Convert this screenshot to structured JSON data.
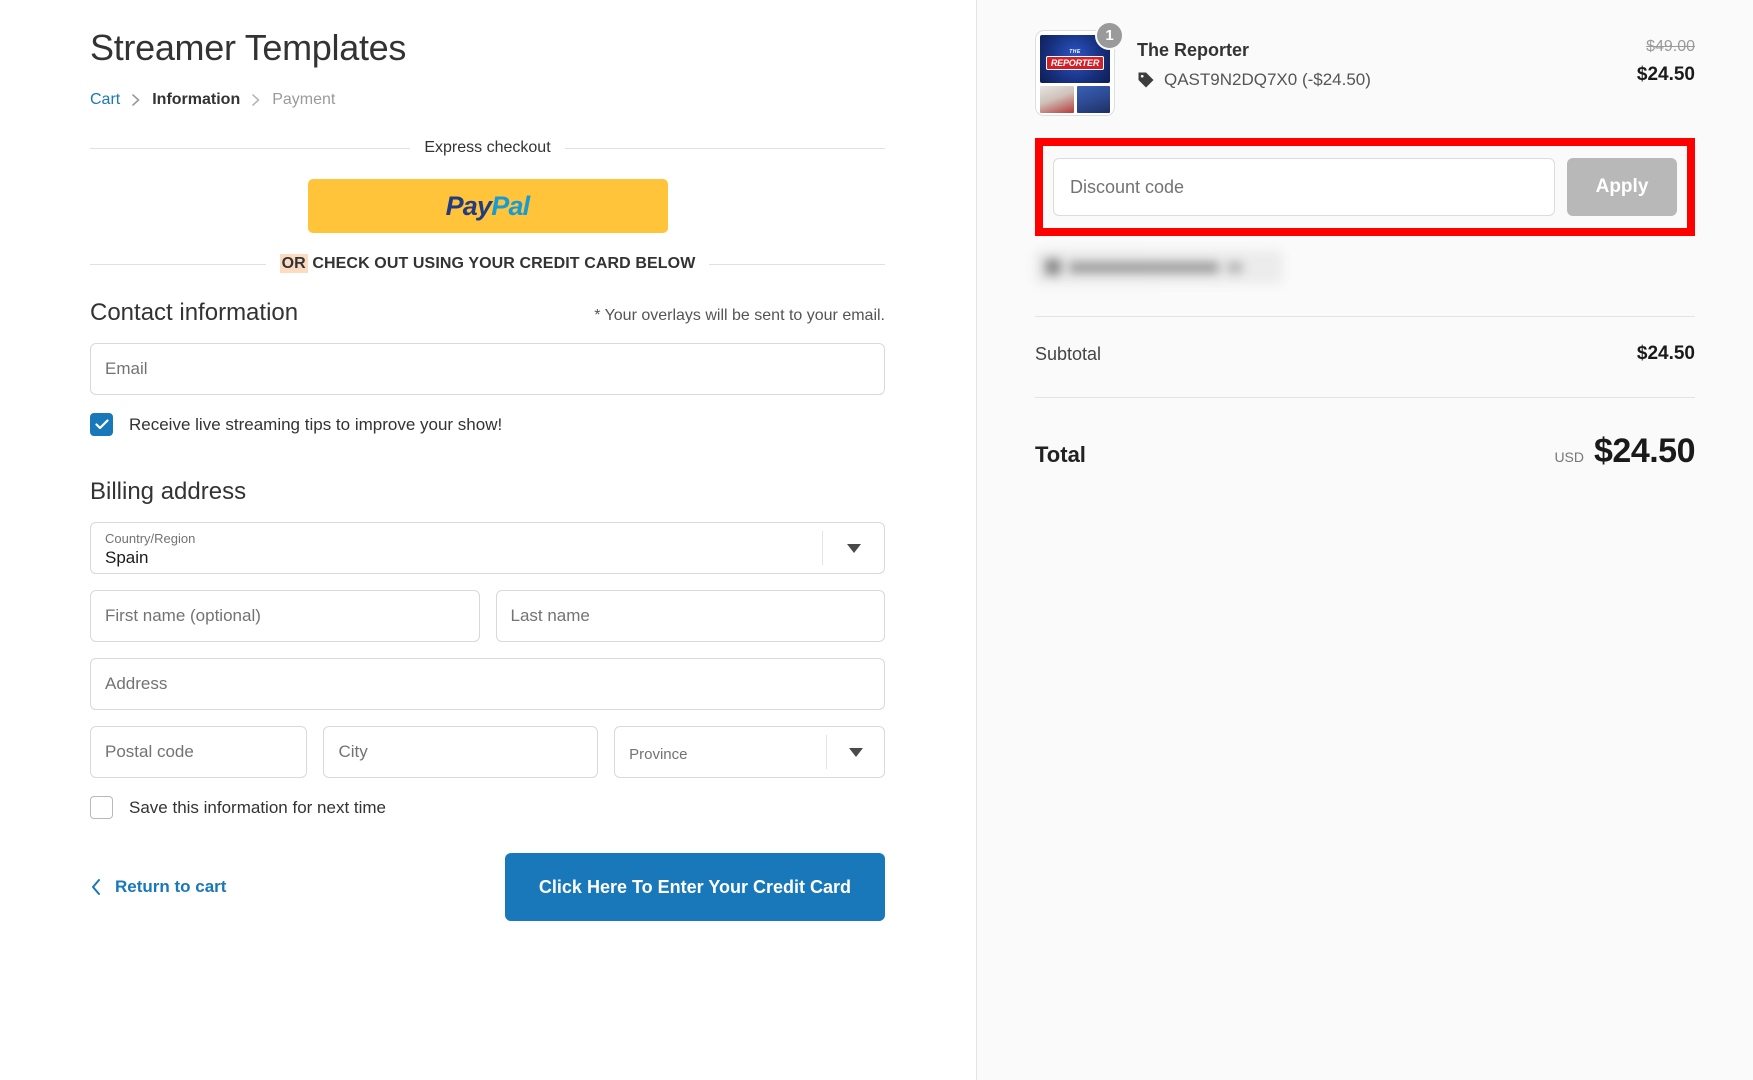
{
  "shop": {
    "title": "Streamer Templates"
  },
  "breadcrumb": {
    "cart": "Cart",
    "information": "Information",
    "payment": "Payment"
  },
  "express": {
    "divider_label": "Express checkout",
    "paypal_pay": "Pay",
    "paypal_pal": "Pal",
    "or_label": "OR",
    "or_rest": "CHECK OUT USING YOUR CREDIT CARD BELOW"
  },
  "contact": {
    "title": "Contact information",
    "note": "* Your overlays will be sent to your email.",
    "email_placeholder": "Email",
    "newsletter_label": "Receive live streaming tips to improve your show!",
    "newsletter_checked": true
  },
  "billing": {
    "title": "Billing address",
    "country_label": "Country/Region",
    "country_value": "Spain",
    "first_name_placeholder": "First name (optional)",
    "last_name_placeholder": "Last name",
    "address_placeholder": "Address",
    "postal_placeholder": "Postal code",
    "city_placeholder": "City",
    "province_placeholder": "Province",
    "save_info_label": "Save this information for next time",
    "save_info_checked": false
  },
  "actions": {
    "return_to_cart": "Return to cart",
    "submit_label": "Click Here To Enter Your Credit Card"
  },
  "summary": {
    "item": {
      "name": "The Reporter",
      "quantity": "1",
      "discount_text": "QAST9N2DQ7X0 (-$24.50)",
      "original_price": "$49.00",
      "price": "$24.50",
      "thumbnail_brand_the": "THE",
      "thumbnail_brand_name": "REPORTER"
    },
    "discount": {
      "placeholder": "Discount code",
      "apply_label": "Apply"
    },
    "subtotal_label": "Subtotal",
    "subtotal_value": "$24.50",
    "total_label": "Total",
    "total_currency": "USD",
    "total_value": "$24.50"
  },
  "colors": {
    "accent_blue": "#1878b9",
    "paypal_yellow": "#ffc439",
    "annotation_red": "#ff0000",
    "apply_gray": "#b8b8b8",
    "highlight_peach": "#fbdcc0"
  }
}
